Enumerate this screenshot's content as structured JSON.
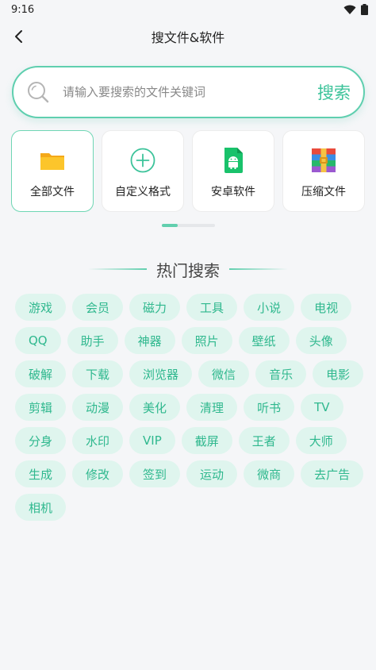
{
  "status_bar": {
    "time": "9:16"
  },
  "header": {
    "title": "搜文件&软件"
  },
  "search": {
    "placeholder": "请输入要搜索的文件关键词",
    "button_label": "搜索"
  },
  "categories": [
    {
      "label": "全部文件",
      "icon": "folder-icon",
      "color": "#f5b51b"
    },
    {
      "label": "自定义格式",
      "icon": "plus-circle-icon",
      "color": "#3cc39a"
    },
    {
      "label": "安卓软件",
      "icon": "android-icon",
      "color": "#19c26b"
    },
    {
      "label": "压缩文件",
      "icon": "archive-icon",
      "color": "#e94b3c"
    }
  ],
  "hot": {
    "title": "热门搜索",
    "tags": [
      "游戏",
      "会员",
      "磁力",
      "工具",
      "小说",
      "电视",
      "QQ",
      "助手",
      "神器",
      "照片",
      "壁纸",
      "头像",
      "破解",
      "下载",
      "浏览器",
      "微信",
      "音乐",
      "电影",
      "剪辑",
      "动漫",
      "美化",
      "清理",
      "听书",
      "TV",
      "分身",
      "水印",
      "VIP",
      "截屏",
      "王者",
      "大师",
      "生成",
      "修改",
      "签到",
      "运动",
      "微商",
      "去广告",
      "相机"
    ]
  },
  "colors": {
    "accent": "#3cc39a",
    "tag_bg": "#dff5ee",
    "tag_text": "#2fb88e"
  }
}
